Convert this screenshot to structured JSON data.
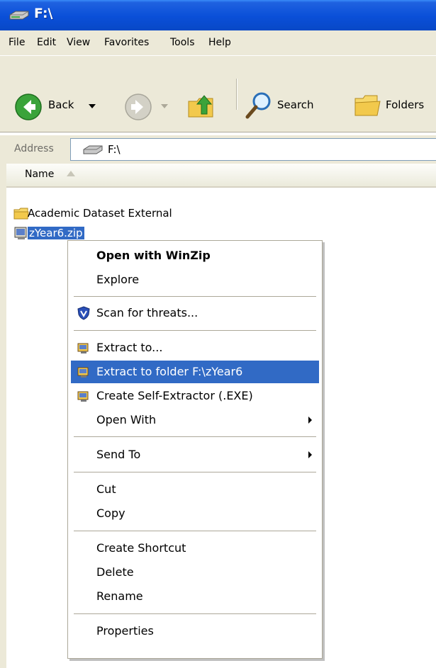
{
  "window": {
    "title": "F:\\"
  },
  "menubar": {
    "items": [
      "File",
      "Edit",
      "View",
      "Favorites",
      "Tools",
      "Help"
    ]
  },
  "toolbar": {
    "back_label": "Back",
    "search_label": "Search",
    "folders_label": "Folders"
  },
  "address": {
    "label": "Address",
    "value": "F:\\"
  },
  "columns": {
    "name": "Name"
  },
  "files": [
    {
      "name": "Academic Dataset External",
      "icon": "folder-icon"
    },
    {
      "name": "zYear6.zip",
      "icon": "winzip-archive-icon"
    }
  ],
  "context_menu": {
    "items": [
      {
        "label": "Open with WinZip",
        "bold": true
      },
      {
        "label": "Explore"
      },
      {
        "label": "Scan for threats...",
        "icon": "shield-icon"
      },
      {
        "label": "Extract to...",
        "icon": "winzip-icon"
      },
      {
        "label": "Extract to folder F:\\zYear6",
        "icon": "winzip-icon",
        "highlighted": true
      },
      {
        "label": "Create Self-Extractor (.EXE)",
        "icon": "winzip-icon"
      },
      {
        "label": "Open With",
        "submenu": true
      },
      {
        "label": "Send To",
        "submenu": true
      },
      {
        "label": "Cut"
      },
      {
        "label": "Copy"
      },
      {
        "label": "Create Shortcut"
      },
      {
        "label": "Delete"
      },
      {
        "label": "Rename"
      },
      {
        "label": "Properties"
      }
    ]
  },
  "colors": {
    "titlebar": "#0a4fd8",
    "chrome": "#ece9d8",
    "highlight": "#316ac5"
  }
}
